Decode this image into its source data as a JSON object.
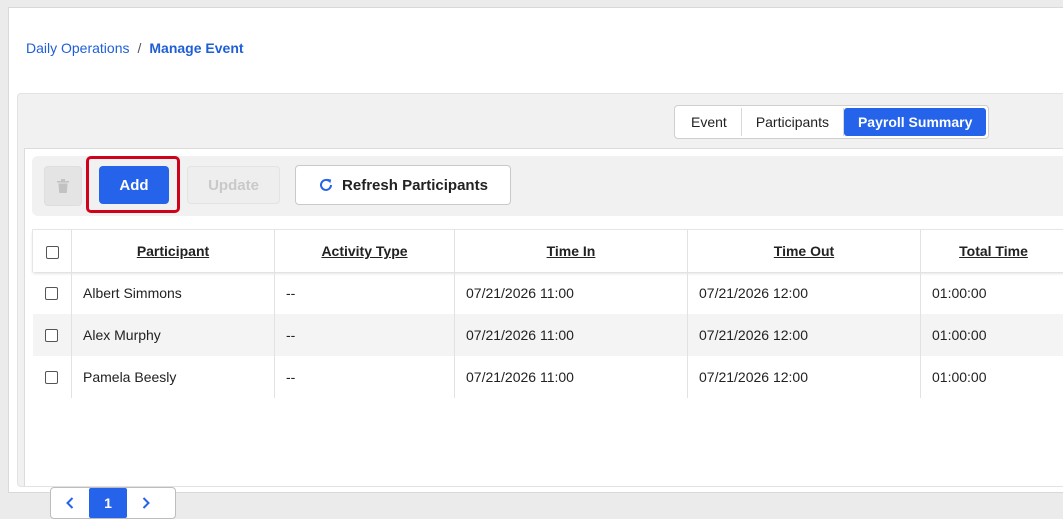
{
  "breadcrumb": {
    "parent": "Daily Operations",
    "separator": "/",
    "current": "Manage Event"
  },
  "tabs": [
    {
      "label": "Event",
      "active": false
    },
    {
      "label": "Participants",
      "active": false
    },
    {
      "label": "Payroll Summary",
      "active": true
    }
  ],
  "toolbar": {
    "delete_icon": "trash-icon",
    "add_label": "Add",
    "update_label": "Update",
    "refresh_label": "Refresh Participants",
    "refresh_icon": "refresh-icon"
  },
  "table": {
    "columns": [
      "Participant",
      "Activity Type",
      "Time In",
      "Time Out",
      "Total Time"
    ],
    "rows": [
      [
        "Albert Simmons",
        "--",
        "07/21/2026 11:00",
        "07/21/2026 12:00",
        "01:00:00"
      ],
      [
        "Alex Murphy",
        "--",
        "07/21/2026 11:00",
        "07/21/2026 12:00",
        "01:00:00"
      ],
      [
        "Pamela Beesly",
        "--",
        "07/21/2026 11:00",
        "07/21/2026 12:00",
        "01:00:00"
      ]
    ]
  },
  "pagination": {
    "current_page": "1"
  },
  "colors": {
    "accent": "#2563eb",
    "link": "#1f5fd6",
    "highlight": "#d0021b"
  }
}
